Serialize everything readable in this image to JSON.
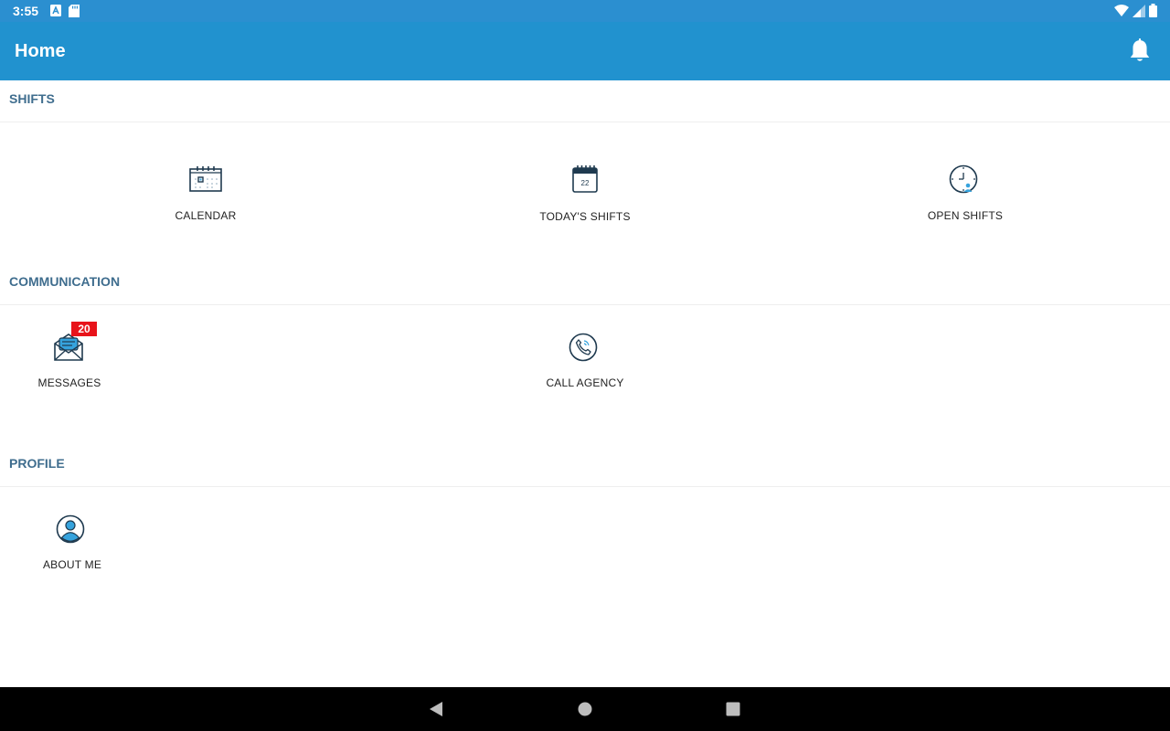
{
  "status_bar": {
    "time": "3:55",
    "icons_left": [
      "a-icon",
      "sd-card-icon"
    ],
    "icons_right": [
      "wifi-icon",
      "cell-signal-icon",
      "battery-icon"
    ]
  },
  "app_bar": {
    "title": "Home",
    "notifications_icon": "bell-icon"
  },
  "sections": {
    "shifts": {
      "title": "SHIFTS",
      "items": {
        "calendar": {
          "label": "CALENDAR",
          "icon": "calendar-icon"
        },
        "todays_shifts": {
          "label": "TODAY'S SHIFTS",
          "icon": "calendar-day-icon",
          "icon_text": "22"
        },
        "open_shifts": {
          "label": "OPEN SHIFTS",
          "icon": "clock-person-icon"
        }
      }
    },
    "communication": {
      "title": "COMMUNICATION",
      "items": {
        "messages": {
          "label": "MESSAGES",
          "icon": "envelope-icon",
          "badge": "20"
        },
        "call_agency": {
          "label": "CALL AGENCY",
          "icon": "phone-icon"
        }
      }
    },
    "profile": {
      "title": "PROFILE",
      "items": {
        "about_me": {
          "label": "ABOUT ME",
          "icon": "user-icon"
        }
      }
    }
  },
  "colors": {
    "status_bar": "#2b8fd0",
    "app_bar": "#2192cf",
    "section_title": "#3f6d8e",
    "icon_dark": "#1f3a4f",
    "icon_accent": "#36a3dd",
    "badge": "#e8131a"
  },
  "nav_bar": {
    "buttons": [
      "back-icon",
      "home-icon",
      "recents-icon"
    ]
  }
}
